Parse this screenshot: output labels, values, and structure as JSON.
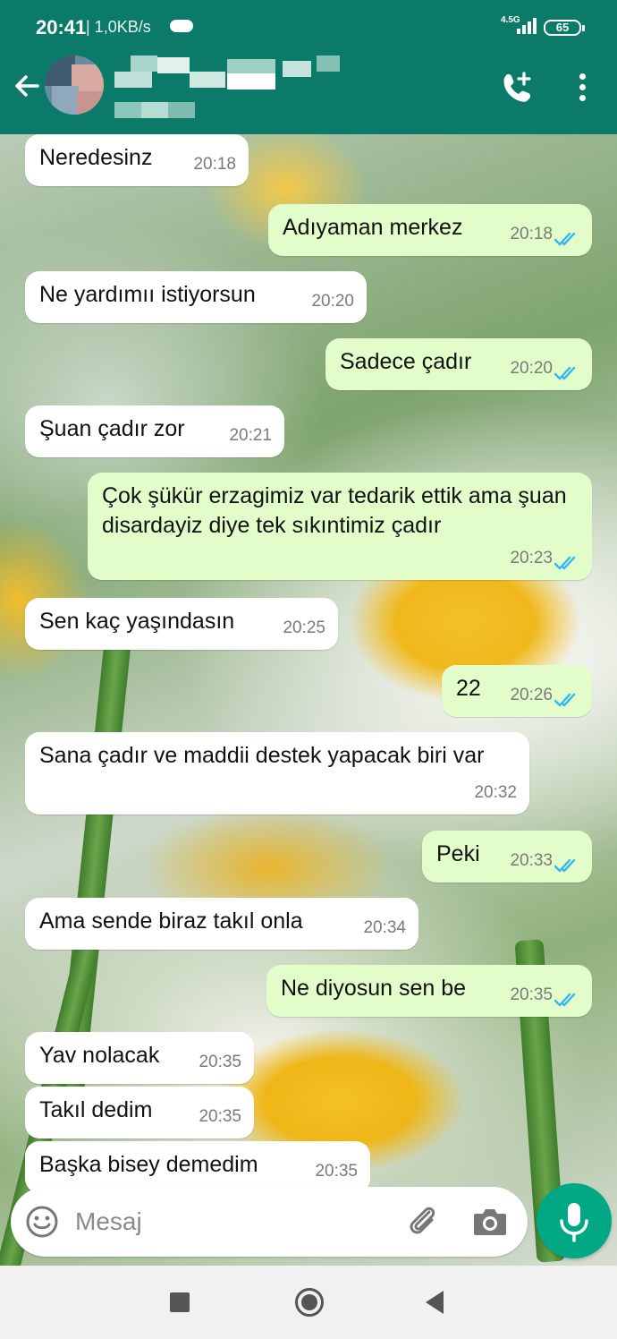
{
  "status_bar": {
    "time": "20:41",
    "speed": "| 1,0KB/s",
    "network": "4.5G",
    "battery": "65"
  },
  "colors": {
    "header": "#0b7a68",
    "outgoing_bubble": "#e2fdc9",
    "incoming_bubble": "#ffffff",
    "read_ticks": "#34b7f1",
    "mic_button": "#00a884"
  },
  "header": {
    "back_icon": "arrow-left-icon",
    "call_icon": "add-call-icon",
    "menu_icon": "more-vert-icon"
  },
  "messages": [
    {
      "text": "Neredesinz",
      "time": "20:18",
      "direction": "in"
    },
    {
      "text": "Adıyaman merkez",
      "time": "20:18",
      "direction": "out",
      "status": "read"
    },
    {
      "text": "Ne yardımıı istiyorsun",
      "time": "20:20",
      "direction": "in"
    },
    {
      "text": "Sadece çadır",
      "time": "20:20",
      "direction": "out",
      "status": "read"
    },
    {
      "text": "Şuan çadır zor",
      "time": "20:21",
      "direction": "in"
    },
    {
      "text": "Çok şükür erzagimiz var tedarik ettik ama şuan disardayiz diye tek sıkıntimiz çadır",
      "time": "20:23",
      "direction": "out",
      "status": "read"
    },
    {
      "text": "Sen kaç yaşındasın",
      "time": "20:25",
      "direction": "in"
    },
    {
      "text": "22",
      "time": "20:26",
      "direction": "out",
      "status": "read"
    },
    {
      "text": "Sana çadır ve maddii destek yapacak biri var",
      "time": "20:32",
      "direction": "in"
    },
    {
      "text": "Peki",
      "time": "20:33",
      "direction": "out",
      "status": "read"
    },
    {
      "text": "Ama sende biraz takıl onla",
      "time": "20:34",
      "direction": "in"
    },
    {
      "text": "Ne diyosun sen be",
      "time": "20:35",
      "direction": "out",
      "status": "read"
    },
    {
      "text": "Yav nolacak",
      "time": "20:35",
      "direction": "in"
    },
    {
      "text": "Takıl dedim",
      "time": "20:35",
      "direction": "in"
    },
    {
      "text": "Başka bisey demedim",
      "time": "20:35",
      "direction": "in"
    }
  ],
  "composer": {
    "placeholder": "Mesaj",
    "emoji_icon": "emoji-icon",
    "attach_icon": "paperclip-icon",
    "camera_icon": "camera-icon",
    "mic_icon": "mic-icon"
  },
  "navbar": {
    "recents_icon": "recents-square-icon",
    "home_icon": "home-circle-icon",
    "back_icon": "back-triangle-icon"
  }
}
